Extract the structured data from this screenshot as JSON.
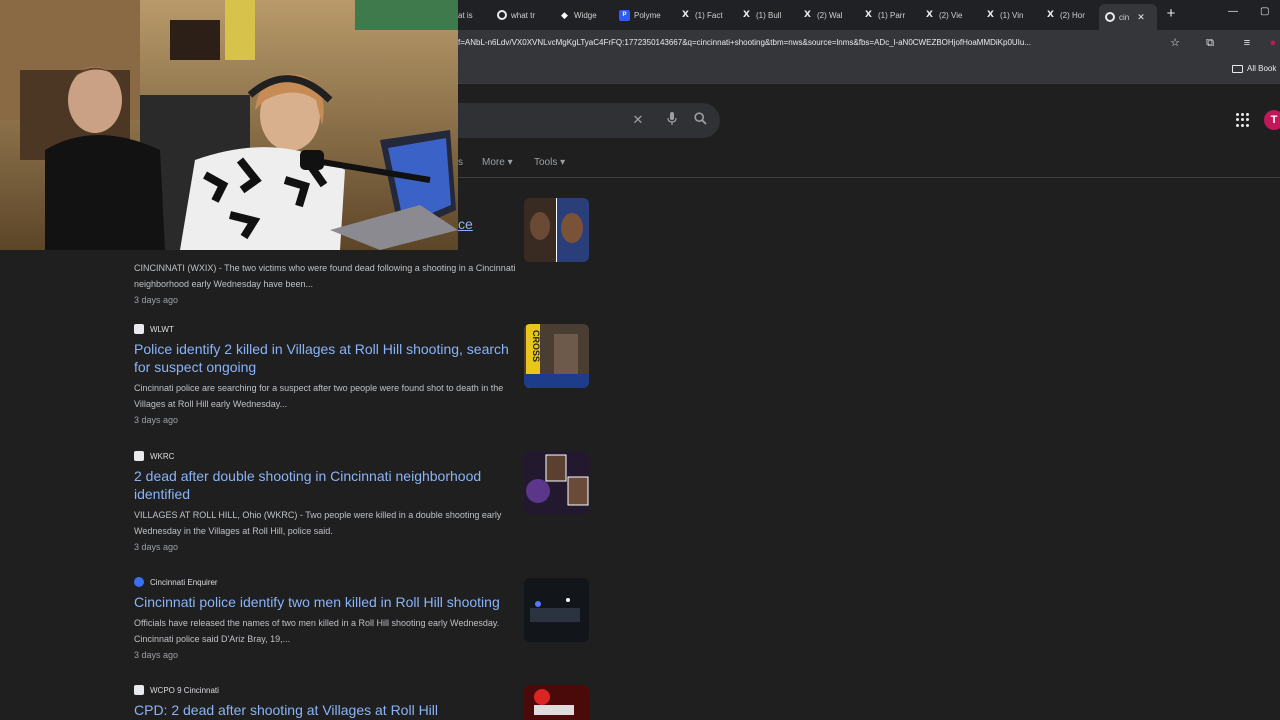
{
  "tabs": [
    {
      "label": "at is",
      "icon": "google-icon"
    },
    {
      "label": "what tr",
      "icon": "chrome-icon"
    },
    {
      "label": "Widge",
      "icon": "widget-icon"
    },
    {
      "label": "Polyme",
      "icon": "polymarket-icon"
    },
    {
      "label": "(1) Fact",
      "icon": "x-icon"
    },
    {
      "label": "(1) Bull",
      "icon": "x-icon"
    },
    {
      "label": "(2) Wal",
      "icon": "x-icon"
    },
    {
      "label": "(1) Parr",
      "icon": "x-icon"
    },
    {
      "label": "(2) Vie",
      "icon": "x-icon"
    },
    {
      "label": "(1) Vin",
      "icon": "x-icon"
    },
    {
      "label": "(2) Hor",
      "icon": "x-icon"
    },
    {
      "label": "cin",
      "icon": "google-icon",
      "active": true
    }
  ],
  "address": {
    "url": "f=ANbL-n6Ldv/VX0XVNLvcMgKgLTyaC4FrFQ:1772350143667&q=cincinnati+shooting&tbm=nws&source=lnms&fbs=ADc_l-aN0CWEZBOHjofHoaMMDiKp0UIu..."
  },
  "bookmarks": {
    "all_label": "All Book"
  },
  "search": {
    "nav": {
      "frag": "s",
      "more": "More",
      "tools": "Tools"
    },
    "clear_icon": "close-icon",
    "voice_icon": "mic-icon",
    "search_icon": "search-icon",
    "avatar_letter": "T"
  },
  "first_result": {
    "title_fragment": "ce",
    "snippet": "CINCINNATI (WXIX) - The two victims who were found dead following a shooting in a Cincinnati neighborhood early Wednesday have been...",
    "age": "3 days ago"
  },
  "results": [
    {
      "source": "WLWT",
      "title": "Police identify 2 killed in Villages at Roll Hill shooting, search for suspect ongoing",
      "snippet": "Cincinnati police are searching for a suspect after two people were found shot to death in the Villages at Roll Hill early Wednesday...",
      "age": "3 days ago",
      "thumb_word": "CROSS"
    },
    {
      "source": "WKRC",
      "title": "2 dead after double shooting in Cincinnati neighborhood identified",
      "snippet": "VILLAGES AT ROLL HILL, Ohio (WKRC) - Two people were killed in a double shooting early Wednesday in the Villages at Roll Hill, police said.",
      "age": "3 days ago"
    },
    {
      "source": "Cincinnati Enquirer",
      "title": "Cincinnati police identify two men killed in Roll Hill shooting",
      "snippet": "Officials have released the names of two men killed in a Roll Hill shooting early Wednesday. Cincinnati police said D'Ariz Bray, 19,...",
      "age": "3 days ago"
    },
    {
      "source": "WCPO 9 Cincinnati",
      "title": "CPD: 2 dead after shooting at Villages at Roll Hill",
      "snippet": "",
      "age": ""
    }
  ],
  "colors": {
    "link": "#8ab4f8",
    "page_bg": "#1f1f1f",
    "avatar": "#c2185b"
  }
}
